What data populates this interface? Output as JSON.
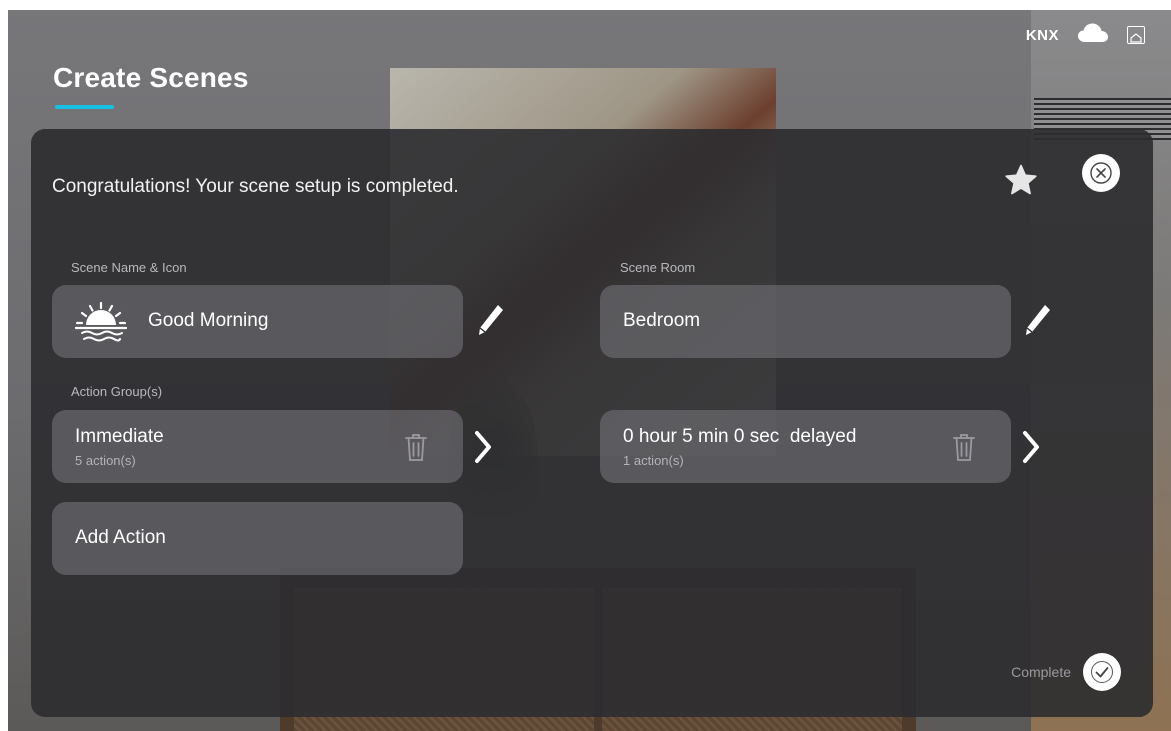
{
  "status_bar": {
    "protocol_label": "KNX",
    "cloud_icon": "cloud-icon",
    "home_icon": "home-box-icon"
  },
  "page": {
    "title": "Create Scenes",
    "accent_color": "#18c0e4"
  },
  "dialog": {
    "message": "Congratulations! Your scene setup is completed.",
    "favorite_icon": "star-icon",
    "close_icon": "close-icon",
    "scene_name_section": {
      "label": "Scene Name & Icon",
      "icon": "sunrise-icon",
      "value": "Good Morning",
      "edit_icon": "pencil-icon"
    },
    "scene_room_section": {
      "label": "Scene Room",
      "value": "Bedroom",
      "edit_icon": "pencil-icon"
    },
    "action_groups": {
      "label": "Action Group(s)",
      "items": [
        {
          "title": "Immediate",
          "subtitle": "5 action(s)"
        },
        {
          "title": "0 hour 5 min 0 sec  delayed",
          "subtitle": "1 action(s)"
        }
      ],
      "add_label": "Add Action"
    },
    "complete": {
      "label": "Complete",
      "icon": "check-icon"
    }
  }
}
